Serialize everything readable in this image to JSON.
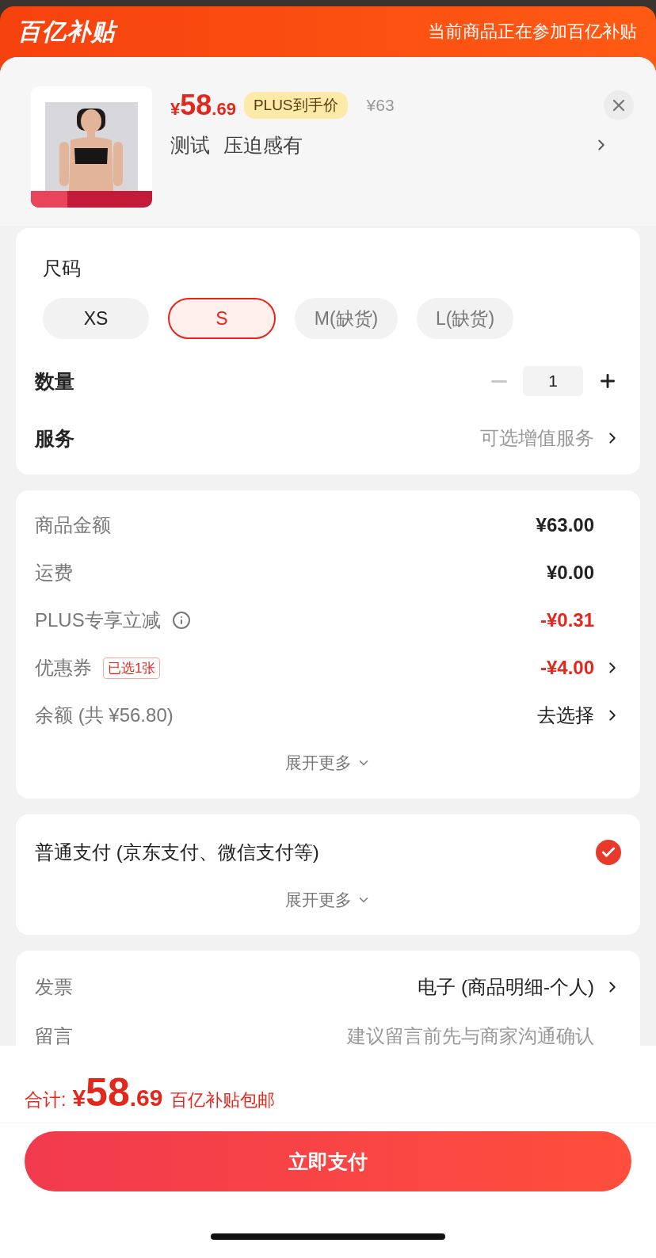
{
  "header": {
    "logo": "百亿补贴",
    "notice": "当前商品正在参加百亿补贴"
  },
  "product": {
    "currency": "¥",
    "price_int": "58",
    "price_dec": ".69",
    "plus_badge": "PLUS到手价",
    "original_price": "¥63",
    "title": "测试 压迫感有"
  },
  "options": {
    "size_label": "尺码",
    "sizes": [
      {
        "label": "XS",
        "selected": false,
        "disabled": false
      },
      {
        "label": "S",
        "selected": true,
        "disabled": false
      },
      {
        "label": "M(缺货)",
        "selected": false,
        "disabled": true
      },
      {
        "label": "L(缺货)",
        "selected": false,
        "disabled": true
      }
    ],
    "quantity": {
      "label": "数量",
      "value": "1",
      "decrease_disabled": true
    },
    "service": {
      "label": "服务",
      "value": "可选增值服务"
    }
  },
  "costs": {
    "rows": [
      {
        "label": "商品金额",
        "value": "¥63.00",
        "kind": "amount",
        "info": false,
        "link": false
      },
      {
        "label": "运费",
        "value": "¥0.00",
        "kind": "amount",
        "info": false,
        "link": false
      },
      {
        "label": "PLUS专享立减",
        "value": "-¥0.31",
        "kind": "discount",
        "info": true,
        "link": false
      },
      {
        "label": "优惠券",
        "badge": "已选1张",
        "value": "-¥4.00",
        "kind": "discount",
        "info": false,
        "link": true
      },
      {
        "label": "余额 (共 ¥56.80)",
        "value": "去选择",
        "kind": "action",
        "info": false,
        "link": true
      }
    ],
    "expand": "展开更多"
  },
  "payment": {
    "methods": [
      {
        "label": "普通支付 (京东支付、微信支付等)",
        "selected": true
      }
    ],
    "expand": "展开更多"
  },
  "extras": [
    {
      "label": "发票",
      "value": "电子 (商品明细-个人)",
      "kind": "action",
      "link": true
    },
    {
      "label": "留言",
      "value": "建议留言前先与商家沟通确认",
      "kind": "hint",
      "link": false
    }
  ],
  "footer": {
    "total_label": "合计:",
    "currency": "¥",
    "total_int": "58",
    "total_dec": ".69",
    "note": "百亿补贴包邮",
    "pay_button": "立即支付"
  }
}
